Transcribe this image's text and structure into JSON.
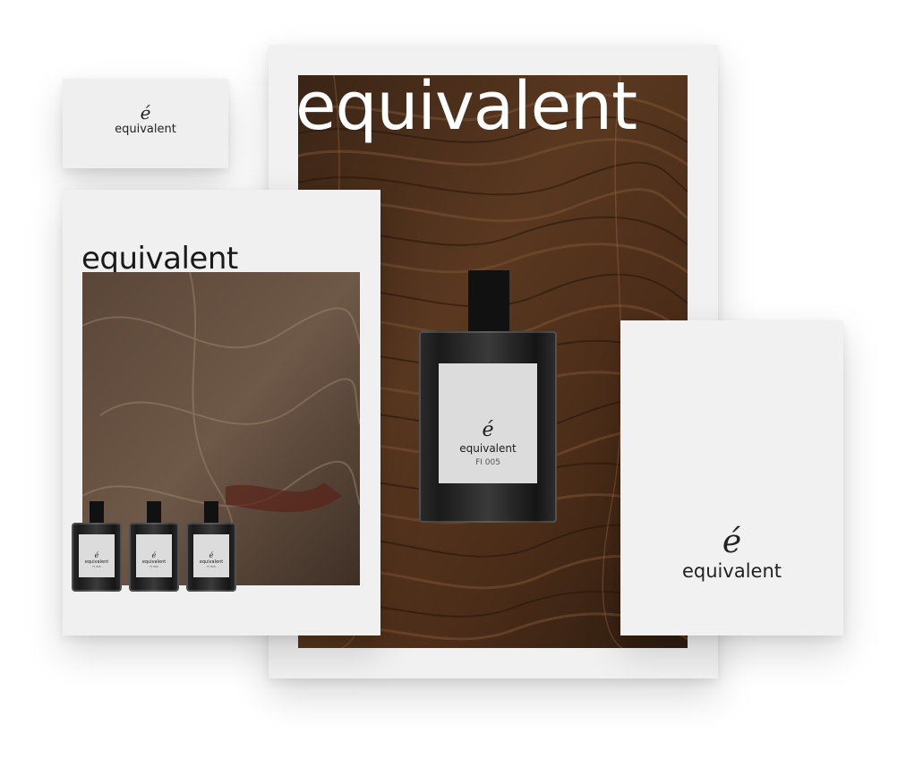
{
  "brand": {
    "name": "equivalent",
    "mark": "é",
    "code": "FI 005",
    "small_code": "FI 005"
  },
  "colors": {
    "background": "#ffffff",
    "card": "#efefef",
    "wood": "#4a2c1a",
    "ink": "#1a1a1a"
  }
}
